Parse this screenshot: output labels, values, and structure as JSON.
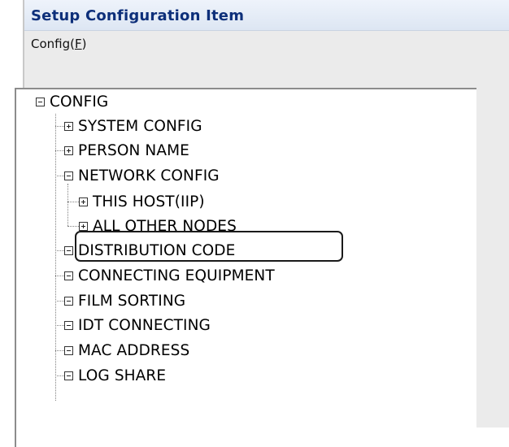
{
  "window": {
    "title": "Setup Configuration Item"
  },
  "menu": {
    "config_label": "Config(",
    "config_accel": "F",
    "config_close": ")"
  },
  "tree": {
    "root": "CONFIG",
    "system_config": "SYSTEM CONFIG",
    "person_name": "PERSON NAME",
    "network_config": "NETWORK CONFIG",
    "this_host": "THIS HOST(IIP)",
    "all_other_nodes": "ALL OTHER NODES",
    "distribution_code": "DISTRIBUTION CODE",
    "connecting_equipment": "CONNECTING EQUIPMENT",
    "film_sorting": "FILM SORTING",
    "idt_connecting": "IDT CONNECTING",
    "mac_address": "MAC ADDRESS",
    "log_share": "LOG SHARE"
  },
  "icons": {
    "expand": "plus-box-icon",
    "collapse": "minus-box-icon"
  },
  "highlighted_item": "ALL OTHER NODES"
}
